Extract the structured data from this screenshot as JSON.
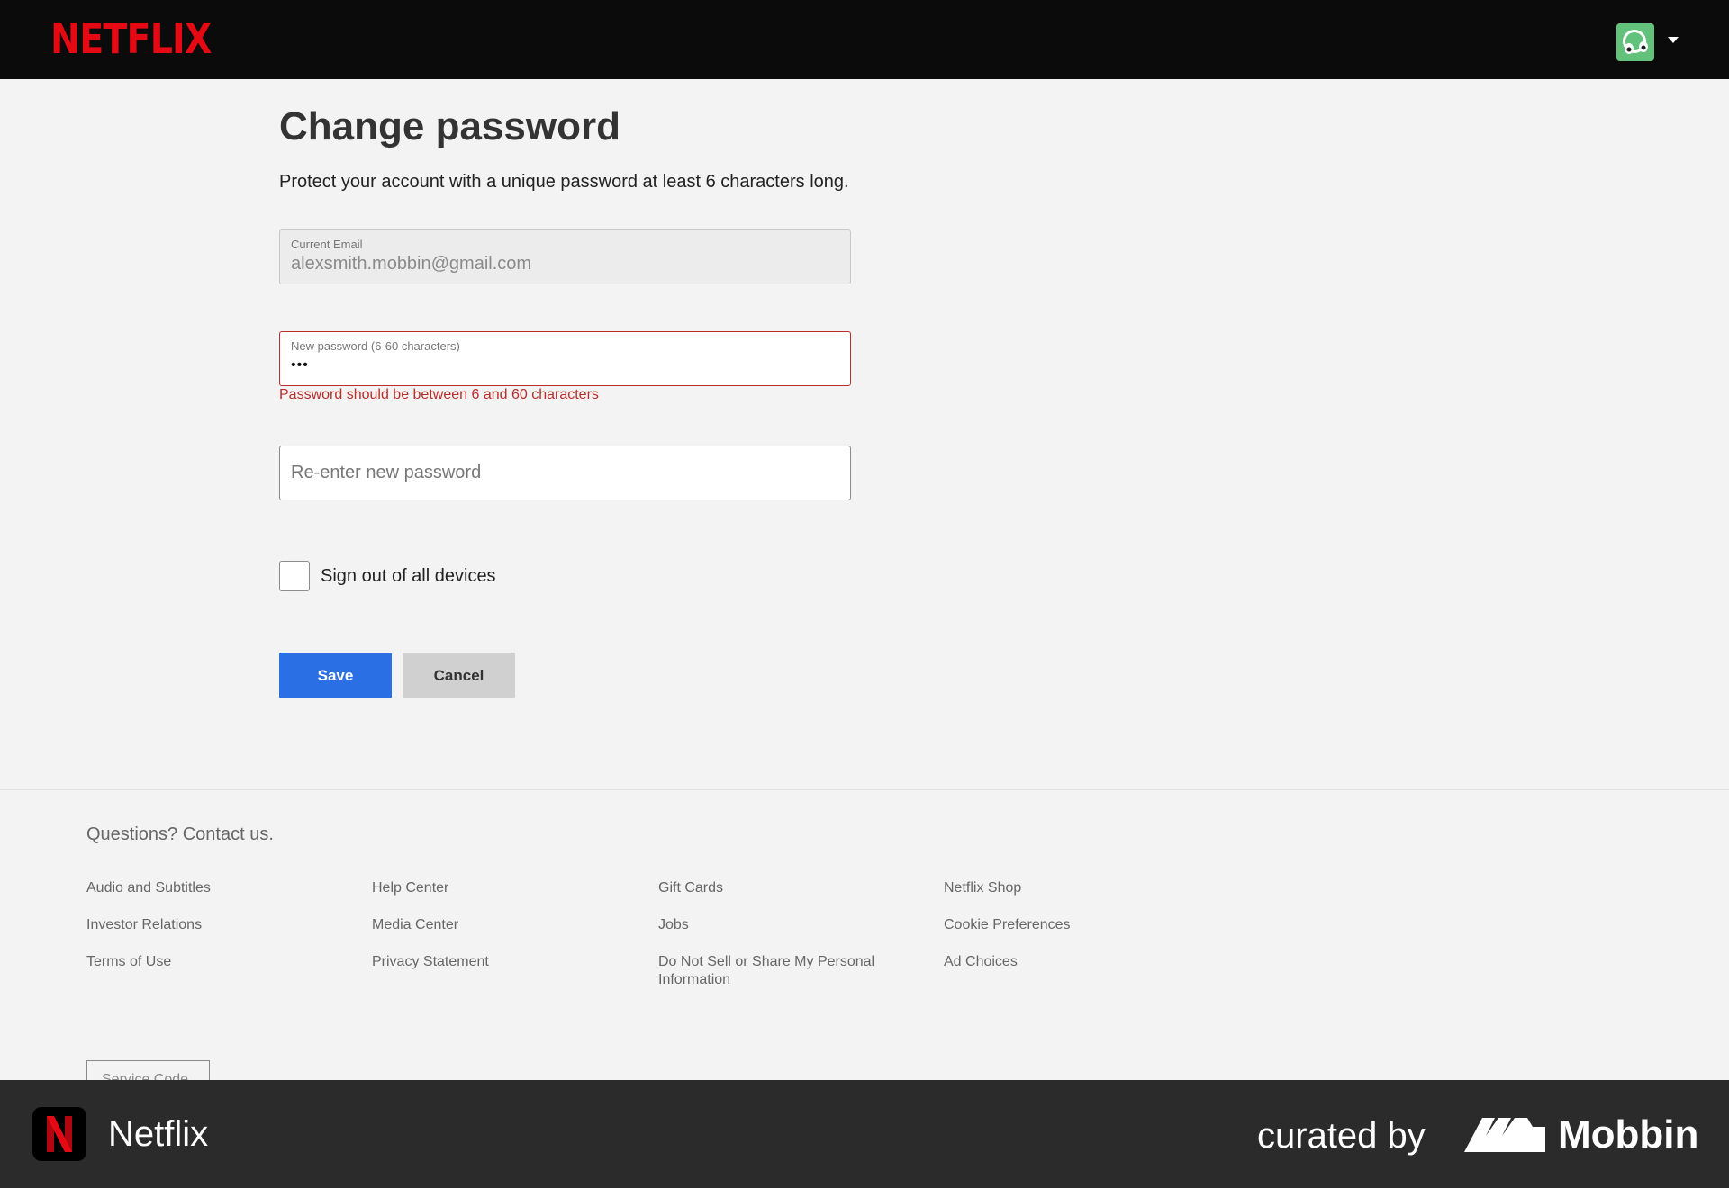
{
  "header": {
    "logo_text": "NETFLIX",
    "brand_color": "#e50914",
    "avatar_icon": "profile-avatar-icon",
    "menu_caret_icon": "caret-down-icon"
  },
  "page": {
    "title": "Change password",
    "subtitle": "Protect your account with a unique password at least 6 characters long."
  },
  "form": {
    "current_email": {
      "label": "Current Email",
      "value": "alexsmith.mobbin@gmail.com"
    },
    "new_password": {
      "label": "New password (6-60 characters)",
      "masked_value": "•••",
      "error": "Password should be between 6 and 60 characters",
      "error_color": "#b92d2b"
    },
    "reenter_password": {
      "placeholder": "Re-enter new password"
    },
    "sign_out_all": {
      "label": "Sign out of all devices",
      "checked": false
    },
    "save_label": "Save",
    "save_color": "#2a6fe3",
    "cancel_label": "Cancel"
  },
  "footer": {
    "contact": "Questions? Contact us.",
    "columns": [
      [
        "Audio and Subtitles",
        "Investor Relations",
        "Terms of Use"
      ],
      [
        "Help Center",
        "Media Center",
        "Privacy Statement"
      ],
      [
        "Gift Cards",
        "Jobs",
        "Do Not Sell or Share My Personal Information"
      ],
      [
        "Netflix Shop",
        "Cookie Preferences",
        "Ad Choices"
      ]
    ],
    "service_code_label": "Service Code"
  },
  "attribution": {
    "app_name": "Netflix",
    "curated_by": "curated by",
    "brand": "Mobbin"
  }
}
